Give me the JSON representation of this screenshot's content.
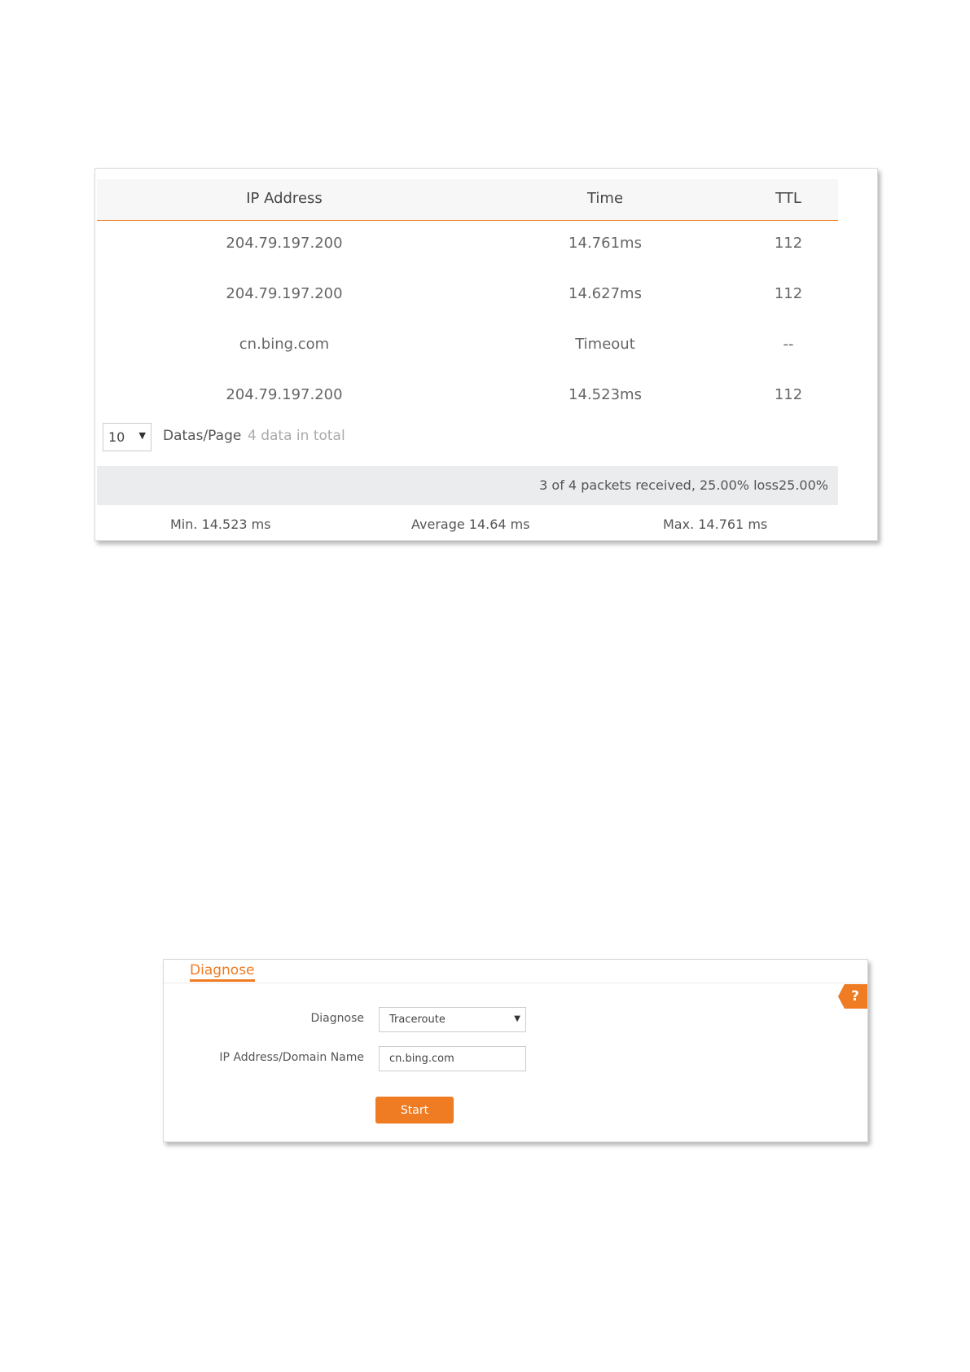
{
  "ping_table": {
    "headers": {
      "ip": "IP Address",
      "time": "Time",
      "ttl": "TTL"
    },
    "rows": [
      {
        "ip": "204.79.197.200",
        "time": "14.761ms",
        "ttl": "112"
      },
      {
        "ip": "204.79.197.200",
        "time": "14.627ms",
        "ttl": "112"
      },
      {
        "ip": "cn.bing.com",
        "time": "Timeout",
        "ttl": "--"
      },
      {
        "ip": "204.79.197.200",
        "time": "14.523ms",
        "ttl": "112"
      }
    ]
  },
  "pager": {
    "per_page": "10",
    "per_page_label": "Datas/Page",
    "total": "4 data in total"
  },
  "summary": {
    "packets": "3 of 4 packets received, 25.00% loss25.00%",
    "min": "Min. 14.523 ms",
    "average": "Average 14.64 ms",
    "max": "Max. 14.761 ms"
  },
  "diagnose": {
    "tab": "Diagnose",
    "help": "?",
    "diagnose_label": "Diagnose",
    "diagnose_value": "Traceroute",
    "ip_label": "IP Address/Domain Name",
    "ip_value": "cn.bing.com",
    "start_label": "Start"
  },
  "colors": {
    "accent": "#ef7b22",
    "summary_bg": "#eaecee"
  }
}
